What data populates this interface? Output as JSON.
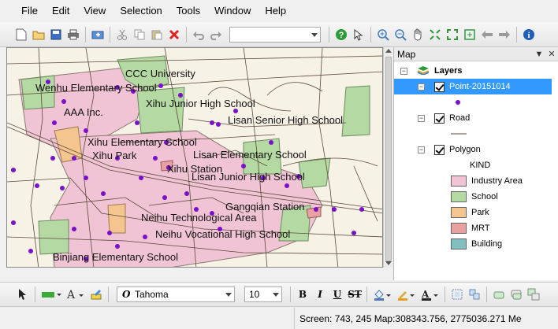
{
  "menu": [
    "File",
    "Edit",
    "View",
    "Selection",
    "Tools",
    "Window",
    "Help"
  ],
  "map_panel": {
    "title": "Map",
    "pin_icon": "pin-icon",
    "close_icon": "close-icon"
  },
  "layers": {
    "root_label": "Layers",
    "point_layer": "Point-20151014",
    "road_layer": "Road",
    "polygon_layer": "Polygon",
    "kind_header": "KIND",
    "legend": [
      {
        "label": "Industry Area",
        "color": "#f0c4d4"
      },
      {
        "label": "School",
        "color": "#b5d9a2"
      },
      {
        "label": "Park",
        "color": "#f4c58e"
      },
      {
        "label": "MRT",
        "color": "#e8a0a0"
      },
      {
        "label": "Building",
        "color": "#82c0c0"
      }
    ]
  },
  "map_labels": [
    "CCC University",
    "Wenhu Elementary School",
    "Xihu Junior High School",
    "AAA Inc.",
    "Lisan Senior High School",
    "Xihu Elementary School",
    "Xihu Park",
    "Lisan Elementary School",
    "Xihu Station",
    "Lisan Junior High School",
    "Gangqian Station",
    "Neihu Technological Area",
    "Neihu Vocational High School",
    "Binjiang Elementary School"
  ],
  "format_toolbar": {
    "font": "Tahoma",
    "size": "10",
    "bold": "B",
    "italic": "I",
    "underline": "U",
    "strike": "ST",
    "text_icon": "A"
  },
  "status": {
    "text": "Screen: 743, 245  Map:308343.756, 2775036.271 Me"
  },
  "colors": {
    "industry": "#f0c4d4",
    "school": "#b5d9a2",
    "park": "#f4c58e",
    "mrt": "#e8a0a0",
    "point": "#7a10c8",
    "road": "#5a4a3a",
    "selection": "#3399ff"
  }
}
